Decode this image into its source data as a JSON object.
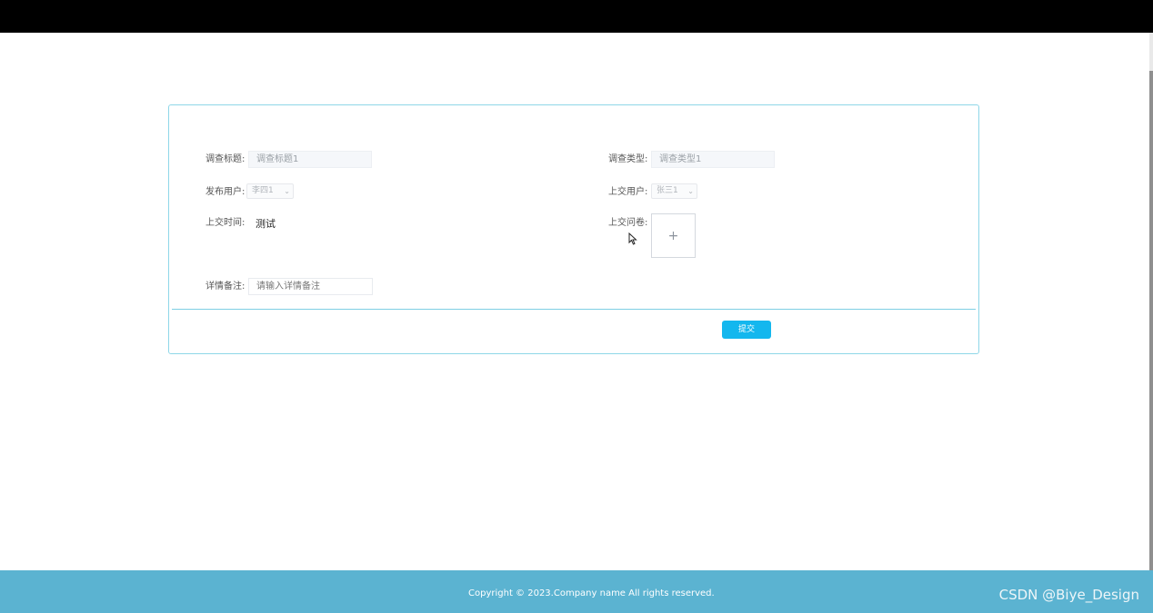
{
  "form": {
    "survey_title": {
      "label": "调查标题:",
      "value": "调查标题1"
    },
    "survey_type": {
      "label": "调查类型:",
      "value": "调查类型1"
    },
    "publisher": {
      "label": "发布用户:",
      "value": "李四1"
    },
    "submitter": {
      "label": "上交用户:",
      "value": "张三1"
    },
    "submit_time": {
      "label": "上交时间:",
      "value": "测试"
    },
    "questionnaire": {
      "label": "上交问卷:",
      "upload_symbol": "+"
    },
    "details": {
      "label": "详情备注:",
      "placeholder": "请输入详情备注"
    },
    "submit_label": "提交"
  },
  "footer": {
    "copyright": "Copyright © 2023.Company name All rights reserved.",
    "watermark": "CSDN @Biye_Design"
  },
  "colors": {
    "topbar": "#000000",
    "card_border": "#8fd7e8",
    "submit_button": "#14b7ee",
    "footer": "#5bb3d1"
  }
}
